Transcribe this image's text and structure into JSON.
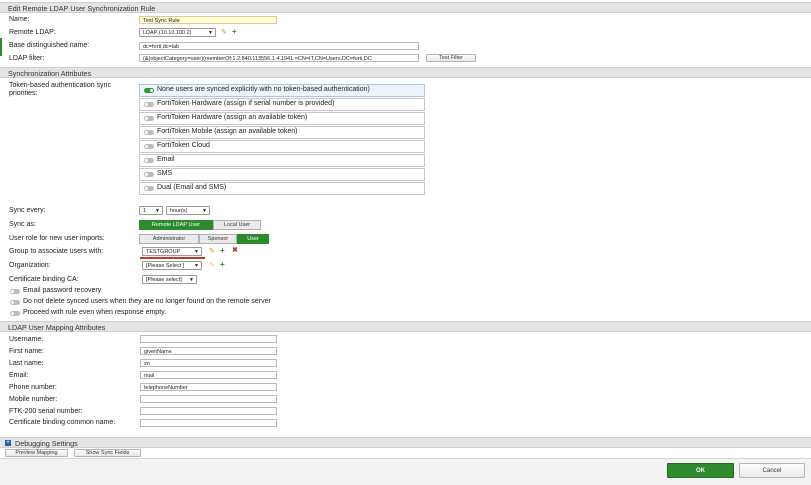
{
  "sections": {
    "edit": "Edit Remote LDAP User Synchronization Rule",
    "sync_attrs": "Synchronization Attributes",
    "mapping": "LDAP User Mapping Attributes",
    "debugging": "Debugging Settings"
  },
  "general": {
    "name_label": "Name:",
    "name_value": "Test Sync Rule",
    "remote_ldap_label": "Remote LDAP:",
    "remote_ldap_value": "LDAP (10.10.100.2)",
    "base_dn_label": "Base distinguished name:",
    "base_dn_value": "dc=forti,dc=lab",
    "filter_label": "LDAP filter:",
    "filter_value": "(&(objectCategory=user)(memberOf:1.2.840.113556.1.4.1941:=CN=IT,CN=Users,DC=forti,DC",
    "test_filter": "Test Filter"
  },
  "sync": {
    "priorities_label": "Token-based authentication sync priorities:",
    "priorities": [
      "None users are synced explicitly with no token-based authentication)",
      "FortiToken Hardware (assign if serial number is provided)",
      "FortiToken Hardware (assign an available token)",
      "FortiToken Mobile (assign an available token)",
      "FortiToken Cloud",
      "Email",
      "SMS",
      "Dual (Email and SMS)"
    ],
    "sync_every_label": "Sync every:",
    "sync_every_value": "1",
    "sync_every_unit": "hour(s)",
    "sync_as_label": "Sync as:",
    "sync_as_options": [
      "Remote LDAP User",
      "Local User"
    ],
    "role_label": "User role for new user imports:",
    "role_options": [
      "Administrator",
      "Sponsor",
      "User"
    ],
    "group_label": "Group to associate users with:",
    "group_value": "TESTGROUP",
    "org_label": "Organization:",
    "org_value": "[Please Select ]",
    "cert_ca_label": "Certificate binding CA:",
    "cert_ca_value": "[Please select]",
    "toggles": [
      "Email password recovery",
      "Do not delete synced users when they are no longer found on the remote server",
      "Proceed with rule even when response empty."
    ]
  },
  "mapping_fields": [
    {
      "label": "Username:",
      "value": ""
    },
    {
      "label": "First name:",
      "value": "givenName"
    },
    {
      "label": "Last name:",
      "value": "sn"
    },
    {
      "label": "Email:",
      "value": "mail"
    },
    {
      "label": "Phone number:",
      "value": "telephoneNumber"
    },
    {
      "label": "Mobile number:",
      "value": ""
    },
    {
      "label": "FTK-200 serial number:",
      "value": ""
    },
    {
      "label": "Certificate binding common name:",
      "value": ""
    }
  ],
  "debug": {
    "preview": "Preview Mapping",
    "show_sync": "Show Sync Fields"
  },
  "footer": {
    "ok": "OK",
    "cancel": "Cancel"
  },
  "colors": {
    "accent_green": "#2d8a2d",
    "highlight_input": "#fffbd6",
    "group_underline": "#c0392b"
  }
}
